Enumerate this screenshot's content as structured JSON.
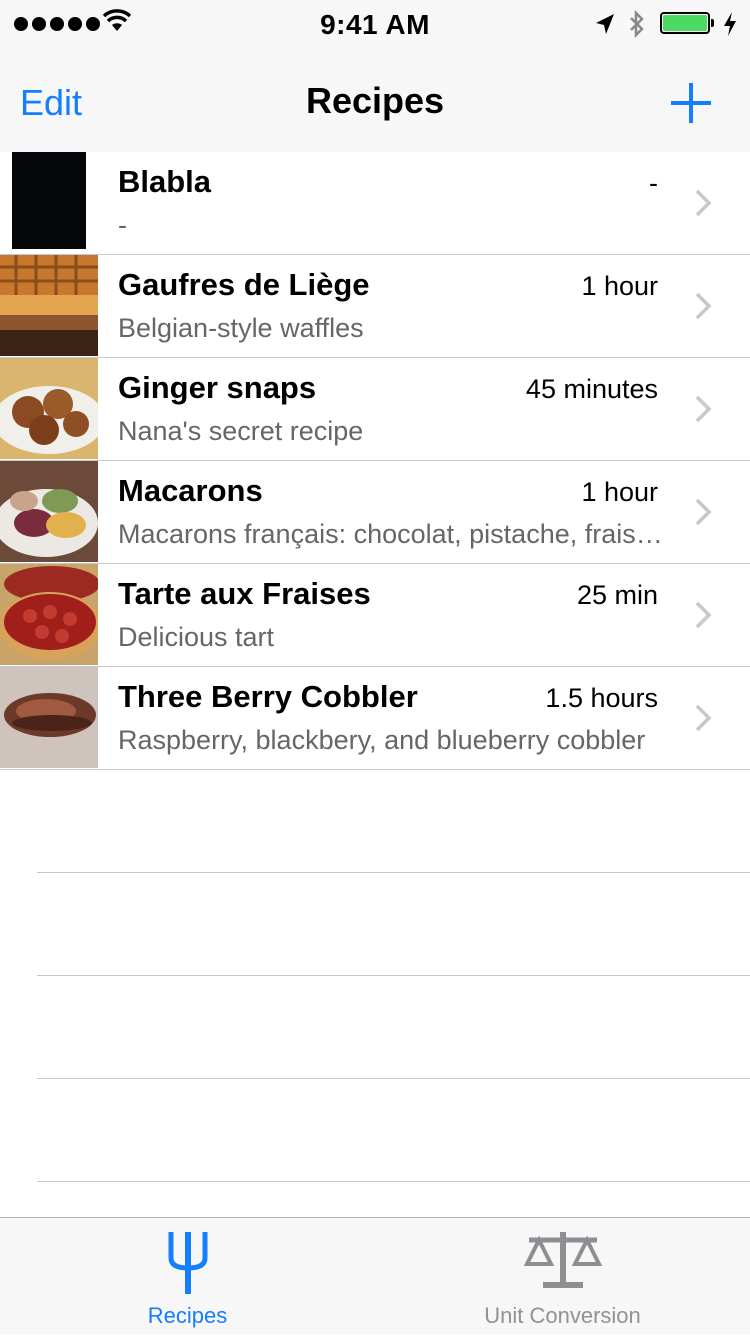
{
  "status_bar": {
    "time": "9:41 AM",
    "signal_icon": "signal-dots-icon",
    "wifi_icon": "wifi-icon",
    "location_icon": "location-arrow-icon",
    "bluetooth_icon": "bluetooth-icon",
    "battery_icon": "battery-charging-icon",
    "battery_color": "#4cd964"
  },
  "nav": {
    "edit_label": "Edit",
    "title": "Recipes",
    "add_icon": "plus-icon",
    "tint_color": "#147efb"
  },
  "recipes": [
    {
      "title": "Blabla",
      "time": "-",
      "subtitle": "-",
      "thumb": "black-thumbnail"
    },
    {
      "title": "Gaufres de Liège",
      "time": "1 hour",
      "subtitle": "Belgian-style waffles",
      "thumb": "waffles-photo"
    },
    {
      "title": "Ginger snaps",
      "time": "45 minutes",
      "subtitle": "Nana's secret recipe",
      "thumb": "ginger-snaps-photo"
    },
    {
      "title": "Macarons",
      "time": "1 hour",
      "subtitle": "Macarons français: chocolat, pistache, fraise, citron",
      "thumb": "macarons-photo"
    },
    {
      "title": "Tarte aux Fraises",
      "time": "25 min",
      "subtitle": "Delicious tart",
      "thumb": "strawberry-tart-photo"
    },
    {
      "title": "Three Berry Cobbler",
      "time": "1.5 hours",
      "subtitle": "Raspberry, blackbery, and blueberry cobbler",
      "thumb": "berry-cobbler-photo"
    }
  ],
  "tabs": [
    {
      "label": "Recipes",
      "icon": "fork-icon",
      "selected": true
    },
    {
      "label": "Unit Conversion",
      "icon": "scale-icon",
      "selected": false
    }
  ]
}
